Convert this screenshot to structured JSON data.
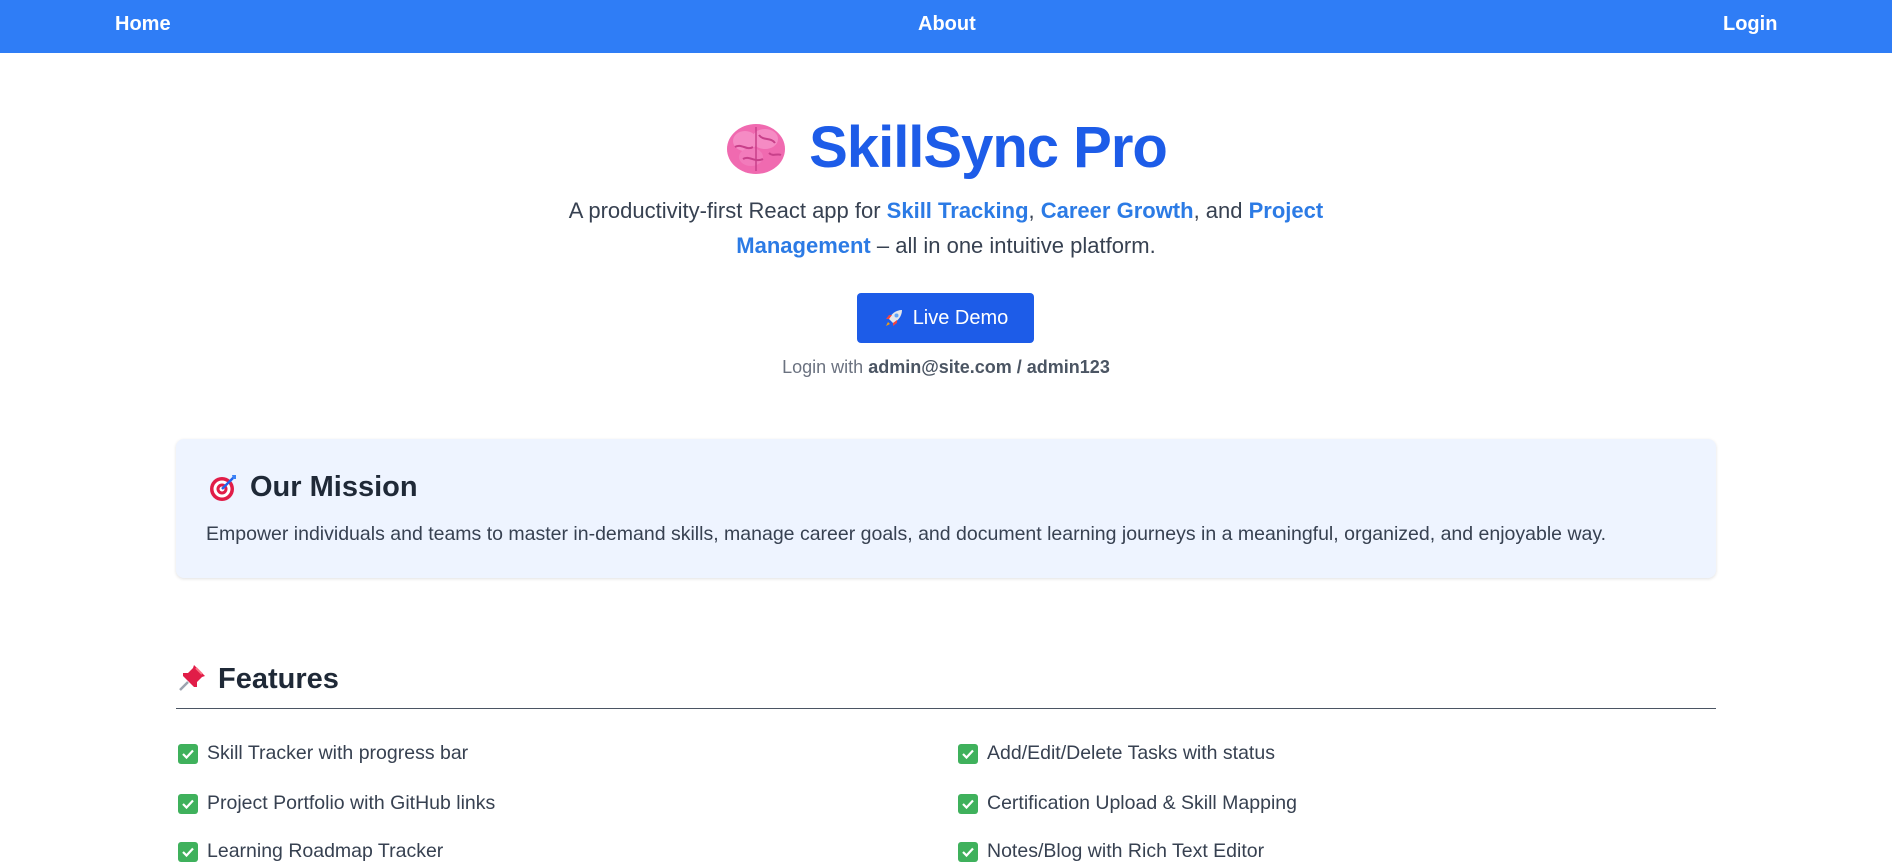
{
  "nav": {
    "home": "Home",
    "about": "About",
    "login": "Login"
  },
  "hero": {
    "title": "SkillSync Pro",
    "icon": "brain-emoji",
    "subtitle_prefix": "A productivity-first React app for ",
    "highlight_1": "Skill Tracking",
    "sep_1": ", ",
    "highlight_2": "Career Growth",
    "sep_2": ", and ",
    "highlight_3": "Project Management",
    "subtitle_suffix": " – all in one intuitive platform.",
    "demo_button": "Live Demo",
    "demo_icon": "rocket-emoji",
    "login_prefix": "Login with ",
    "login_credentials": "admin@site.com / admin123"
  },
  "mission": {
    "icon": "target-emoji",
    "title": "Our Mission",
    "text": "Empower individuals and teams to master in-demand skills, manage career goals, and document learning journeys in a meaningful, organized, and enjoyable way."
  },
  "features": {
    "icon": "pushpin-emoji",
    "title": "Features",
    "items": [
      "Skill Tracker with progress bar",
      "Add/Edit/Delete Tasks with status",
      "Project Portfolio with GitHub links",
      "Certification Upload & Skill Mapping",
      "Learning Roadmap Tracker",
      "Notes/Blog with Rich Text Editor"
    ]
  },
  "colors": {
    "navbar": "#2f7df6",
    "brand": "#1d5ce8",
    "highlight": "#2c7be5",
    "mission_bg": "#eef4ff",
    "check": "#3fb15c"
  }
}
